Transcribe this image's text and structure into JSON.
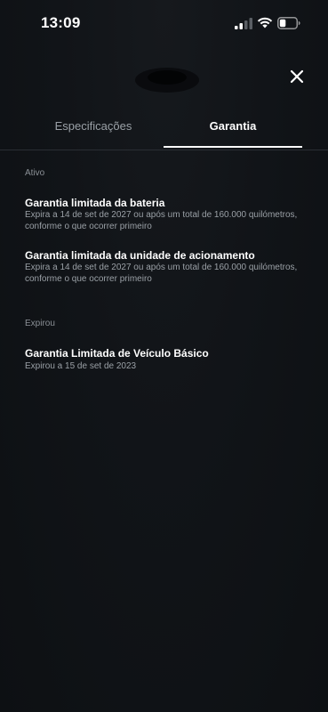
{
  "status_bar": {
    "time": "13:09",
    "signal_icon": "signal-bars-icon",
    "wifi_icon": "wifi-icon",
    "battery_icon": "battery-icon"
  },
  "header": {
    "close_icon": "close-icon"
  },
  "tabs": [
    {
      "label": "Especificações",
      "active": false
    },
    {
      "label": "Garantia",
      "active": true
    }
  ],
  "sections": [
    {
      "label": "Ativo",
      "items": [
        {
          "title": "Garantia limitada da bateria",
          "description": "Expira a 14 de set de 2027 ou após um total de 160.000 quilómetros, conforme o que ocorrer primeiro"
        },
        {
          "title": "Garantia limitada da unidade de acionamento",
          "description": "Expira a 14 de set de 2027 ou após um total de 160.000 quilómetros, conforme o que ocorrer primeiro"
        }
      ]
    },
    {
      "label": "Expirou",
      "items": [
        {
          "title": "Garantia Limitada de Veículo Básico",
          "description": "Expirou a 15 de set de 2023"
        }
      ]
    }
  ],
  "colors": {
    "background": "#111418",
    "text_primary": "#ffffff",
    "text_secondary": "#9aa0a6",
    "divider": "#2a2e34"
  }
}
